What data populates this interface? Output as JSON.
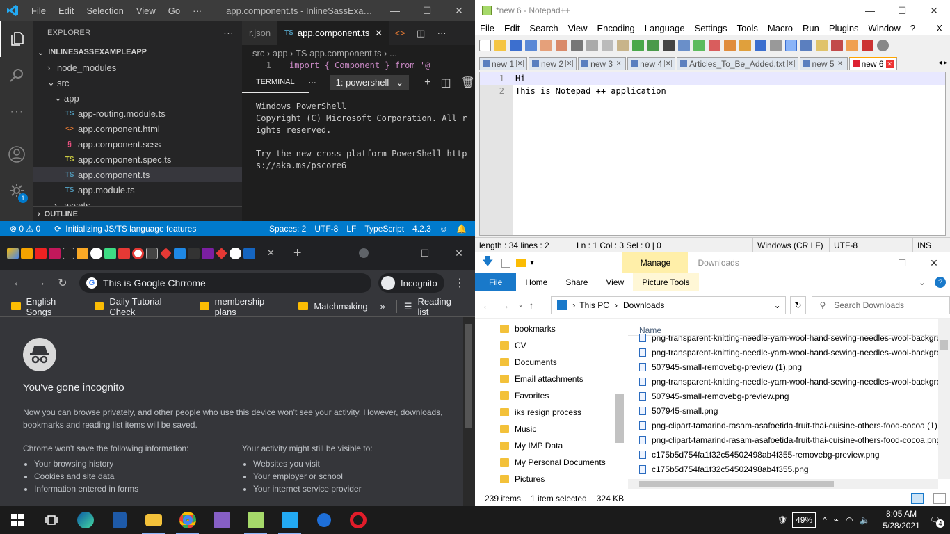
{
  "vscode": {
    "title": "app.component.ts - InlineSassExampleAp...",
    "menu": [
      "File",
      "Edit",
      "Selection",
      "View",
      "Go",
      "···"
    ],
    "explorer_label": "EXPLORER",
    "project": "INLINESASSEXAMPLEAPP",
    "tree": [
      {
        "label": "node_modules",
        "indent": 20,
        "arrow": "›",
        "icon": ""
      },
      {
        "label": "src",
        "indent": 20,
        "arrow": "⌄",
        "icon": ""
      },
      {
        "label": "app",
        "indent": 30,
        "arrow": "⌄",
        "icon": ""
      },
      {
        "label": "app-routing.module.ts",
        "indent": 30,
        "arrow": "",
        "icon": "TS",
        "kind": "ts"
      },
      {
        "label": "app.component.html",
        "indent": 30,
        "arrow": "",
        "icon": "<>",
        "kind": "html"
      },
      {
        "label": "app.component.scss",
        "indent": 30,
        "arrow": "",
        "icon": "§",
        "kind": "scss"
      },
      {
        "label": "app.component.spec.ts",
        "indent": 30,
        "arrow": "",
        "icon": "TS",
        "kind": "spec"
      },
      {
        "label": "app.component.ts",
        "indent": 30,
        "arrow": "",
        "icon": "TS",
        "kind": "ts",
        "selected": true
      },
      {
        "label": "app.module.ts",
        "indent": 30,
        "arrow": "",
        "icon": "TS",
        "kind": "ts"
      },
      {
        "label": "assets",
        "indent": 30,
        "arrow": "›",
        "icon": ""
      }
    ],
    "outline_label": "OUTLINE",
    "tabs": [
      {
        "label": "r.json",
        "active": false
      },
      {
        "label": "app.component.ts",
        "active": true
      }
    ],
    "breadcrumb": "src › app › TS app.component.ts › ...",
    "code_line_no": "1",
    "code_line": "import { Component } from '@",
    "terminal_tab": "TERMINAL",
    "terminal_select": "1: powershell",
    "terminal_text": "Windows PowerShell\nCopyright (C) Microsoft Corporation. All r\nights reserved.\n\nTry the new cross-platform PowerShell http\ns://aka.ms/pscore6",
    "status": {
      "errors": "⊗ 0 ⚠ 0",
      "sync": "Initializing JS/TS language features",
      "spaces": "Spaces: 2",
      "encoding": "UTF-8",
      "eol": "LF",
      "lang": "TypeScript",
      "version": "4.2.3"
    },
    "accounts_badge": "1"
  },
  "npp": {
    "title": "*new 6 - Notepad++",
    "menu": [
      "File",
      "Edit",
      "Search",
      "View",
      "Encoding",
      "Language",
      "Settings",
      "Tools",
      "Macro",
      "Run",
      "Plugins",
      "Window",
      "?"
    ],
    "tabs": [
      {
        "label": "new 1",
        "active": false
      },
      {
        "label": "new 2",
        "active": false
      },
      {
        "label": "new 3",
        "active": false
      },
      {
        "label": "new 4",
        "active": false
      },
      {
        "label": "Articles_To_Be_Added.txt",
        "active": false
      },
      {
        "label": "new 5",
        "active": false
      },
      {
        "label": "new 6",
        "active": true
      }
    ],
    "lines": [
      "Hi",
      "This is Notepad ++ application"
    ],
    "status": [
      "length : 34    lines : 2",
      "Ln : 1    Col : 3    Sel : 0 | 0",
      "Windows (CR LF)",
      "UTF-8",
      "INS"
    ]
  },
  "chrome": {
    "close_x": "✕",
    "omnibox": "This is Google Chrrome",
    "incognito_label": "Incognito",
    "bookmarks": [
      "English Songs",
      "Daily Tutorial Check",
      "membership plans",
      "Matchmaking"
    ],
    "reading_list": "Reading list",
    "heading": "You've gone incognito",
    "intro": "Now you can browse privately, and other people who use this device won't see your activity. However, downloads, bookmarks and reading list items will be saved.",
    "left_title": "Chrome won't save the following information:",
    "left_items": [
      "Your browsing history",
      "Cookies and site data",
      "Information entered in forms"
    ],
    "right_title": "Your activity might still be visible to:",
    "right_items": [
      "Websites you visit",
      "Your employer or school",
      "Your internet service provider"
    ]
  },
  "explorer": {
    "manage": "Manage",
    "title": "Downloads",
    "ribbon": [
      "Home",
      "Share",
      "View"
    ],
    "file_tab": "File",
    "picture_tools": "Picture Tools",
    "path": [
      "This PC",
      "Downloads"
    ],
    "search_placeholder": "Search Downloads",
    "nav": [
      "bookmarks",
      "CV",
      "Documents",
      "Email attachments",
      "Favorites",
      "iks resign process",
      "Music",
      "My IMP Data",
      "My Personal Documents",
      "Pictures"
    ],
    "col_name": "Name",
    "files": [
      "png-transparent-knitting-needle-yarn-wool-hand-sewing-needles-wool-background.png",
      "png-transparent-knitting-needle-yarn-wool-hand-sewing-needles-wool-background (1).png",
      "507945-small-removebg-preview (1).png",
      "png-transparent-knitting-needle-yarn-wool-hand-sewing-needles-wool-background (2).png",
      "507945-small-removebg-preview.png",
      "507945-small.png",
      "png-clipart-tamarind-rasam-asafoetida-fruit-thai-cuisine-others-food-cocoa (1).png",
      "png-clipart-tamarind-rasam-asafoetida-fruit-thai-cuisine-others-food-cocoa.png",
      "c175b5d754fa1f32c54502498ab4f355-removebg-preview.png",
      "c175b5d754fa1f32c54502498ab4f355.png"
    ],
    "status_items": "239 items",
    "status_sel": "1 item selected",
    "status_size": "324 KB"
  },
  "taskbar": {
    "battery": "49%",
    "time": "8:05 AM",
    "date": "5/28/2021",
    "notif": "4"
  }
}
